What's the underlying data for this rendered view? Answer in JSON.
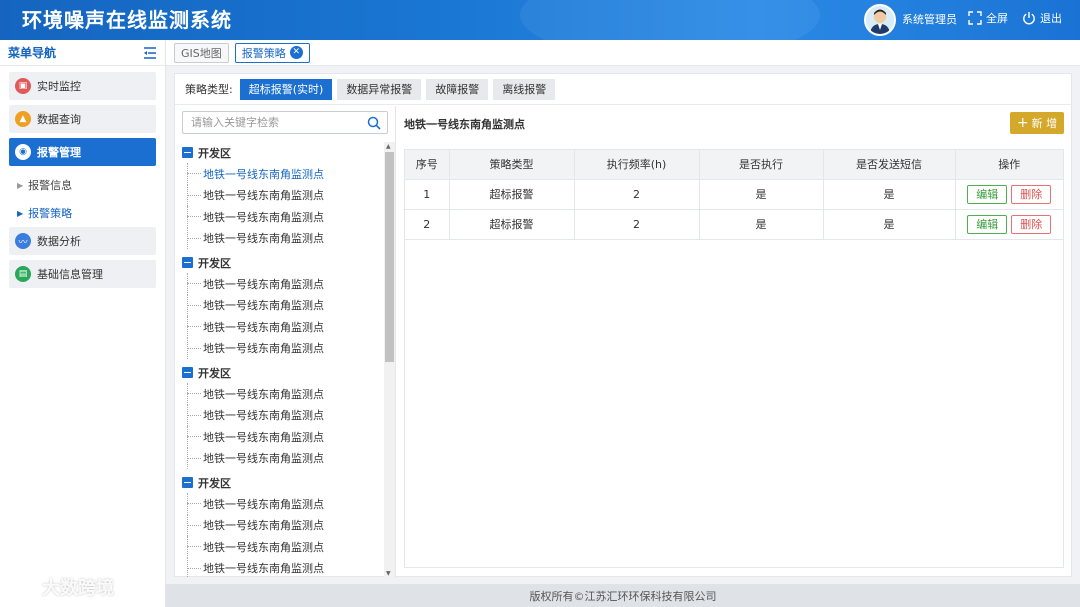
{
  "header": {
    "title": "环境噪声在线监测系统",
    "user": "系统管理员",
    "fullscreen": "全屏",
    "logout": "退出"
  },
  "sidebar": {
    "title": "菜单导航",
    "items": [
      {
        "label": "实时监控",
        "icon": "monitor-icon",
        "color": "#e05a5a"
      },
      {
        "label": "数据查询",
        "icon": "query-icon",
        "color": "#f0a020"
      },
      {
        "label": "报警管理",
        "icon": "alarm-icon",
        "color": "#1a6fd1",
        "active": true
      },
      {
        "label": "数据分析",
        "icon": "chart-icon",
        "color": "#3b7ddd"
      },
      {
        "label": "基础信息管理",
        "icon": "info-icon",
        "color": "#2aa85a"
      }
    ],
    "sub_items": [
      {
        "label": "报警信息"
      },
      {
        "label": "报警策略",
        "active": true
      }
    ]
  },
  "tabs": [
    {
      "label": "GIS地图"
    },
    {
      "label": "报警策略",
      "active": true
    }
  ],
  "strategy": {
    "type_label": "策略类型:",
    "types": [
      "超标报警(实时)",
      "数据异常报警",
      "故障报警",
      "离线报警"
    ]
  },
  "tree": {
    "search_placeholder": "请输入关键字检索",
    "groups": [
      {
        "name": "开发区",
        "leaves": [
          "地铁一号线东南角监测点",
          "地铁一号线东南角监测点",
          "地铁一号线东南角监测点",
          "地铁一号线东南角监测点"
        ]
      },
      {
        "name": "开发区",
        "leaves": [
          "地铁一号线东南角监测点",
          "地铁一号线东南角监测点",
          "地铁一号线东南角监测点",
          "地铁一号线东南角监测点"
        ]
      },
      {
        "name": "开发区",
        "leaves": [
          "地铁一号线东南角监测点",
          "地铁一号线东南角监测点",
          "地铁一号线东南角监测点",
          "地铁一号线东南角监测点"
        ]
      },
      {
        "name": "开发区",
        "leaves": [
          "地铁一号线东南角监测点",
          "地铁一号线东南角监测点",
          "地铁一号线东南角监测点",
          "地铁一号线东南角监测点"
        ]
      }
    ]
  },
  "content": {
    "title": "地铁一号线东南角监测点",
    "add_label": "新 增",
    "columns": [
      "序号",
      "策略类型",
      "执行频率(h)",
      "是否执行",
      "是否发送短信",
      "操作"
    ],
    "rows": [
      [
        "1",
        "超标报警",
        "2",
        "是",
        "是"
      ],
      [
        "2",
        "超标报警",
        "2",
        "是",
        "是"
      ]
    ],
    "edit_label": "编辑",
    "delete_label": "删除"
  },
  "footer": "版权所有©江苏汇环环保科技有限公司",
  "watermark": "大数跨境",
  "colors": {
    "primary": "#1a6fd1",
    "accent_add": "#d4a82a",
    "edit": "#3a9b3d",
    "delete": "#d9534f"
  }
}
